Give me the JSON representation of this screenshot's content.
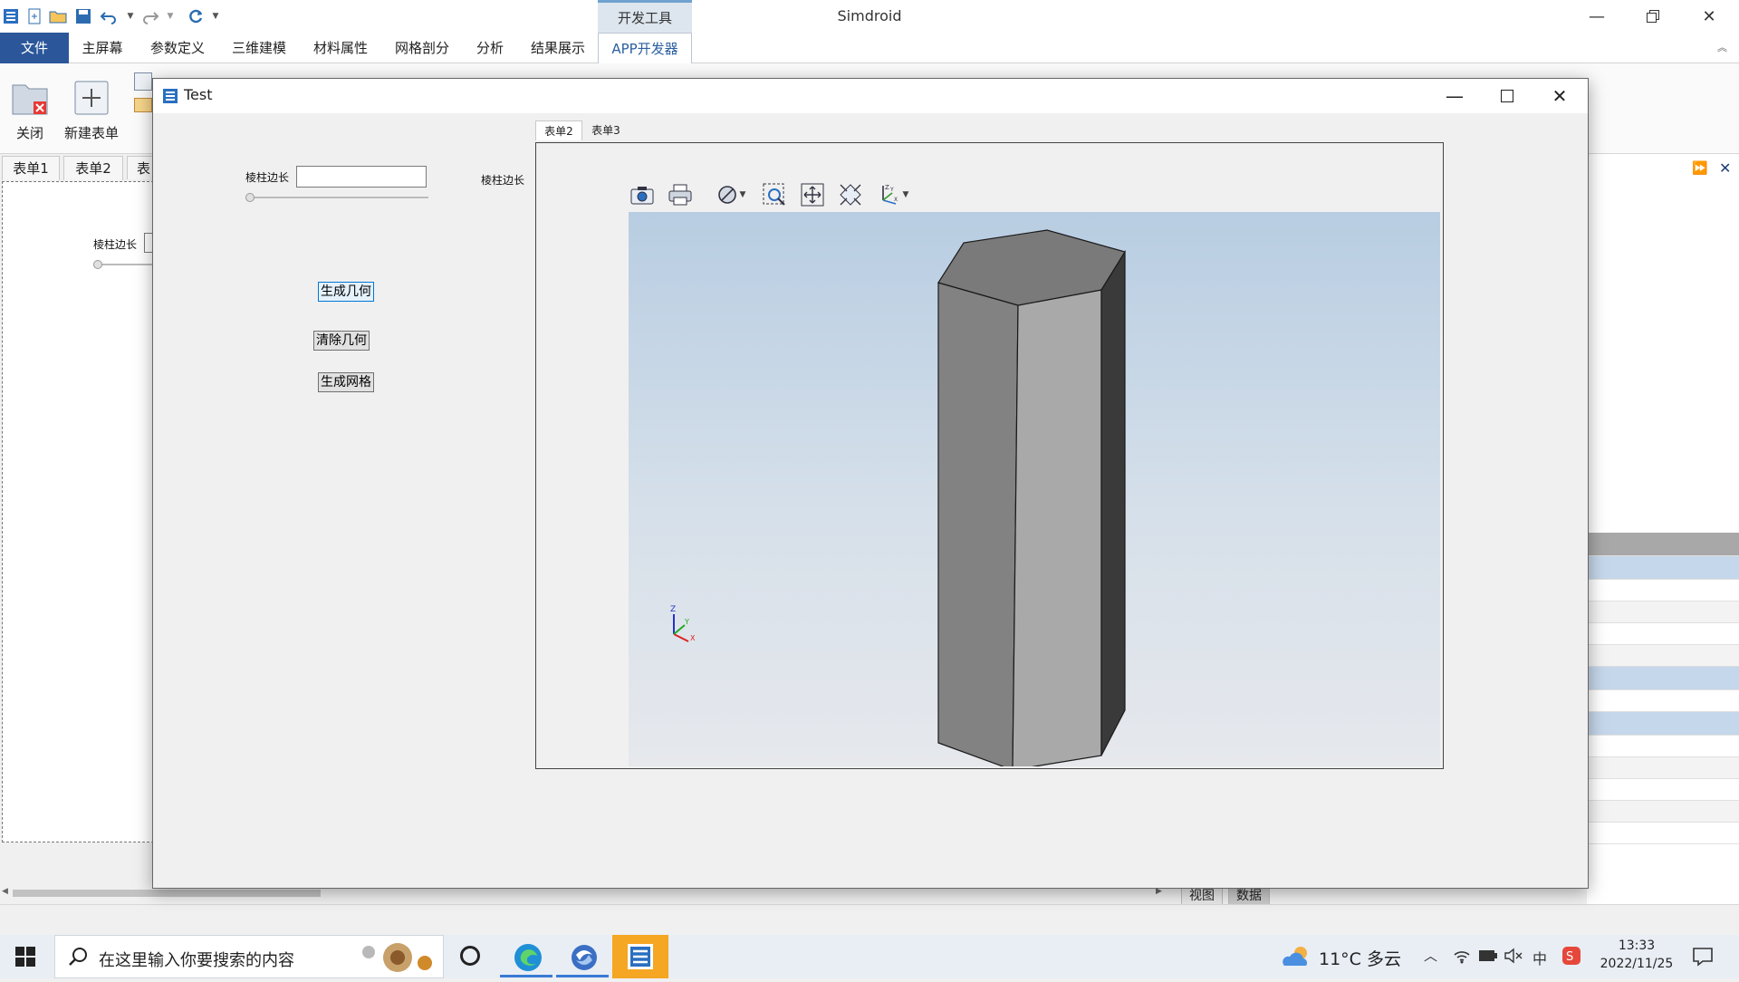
{
  "app": {
    "title": "Simdroid",
    "context_tab": "开发工具"
  },
  "ribbon_tabs": [
    {
      "label": "文件"
    },
    {
      "label": "主屏幕"
    },
    {
      "label": "参数定义"
    },
    {
      "label": "三维建模"
    },
    {
      "label": "材料属性"
    },
    {
      "label": "网格剖分"
    },
    {
      "label": "分析"
    },
    {
      "label": "结果展示"
    },
    {
      "label": "APP开发器"
    }
  ],
  "ribbon": {
    "close_label": "关闭",
    "new_form_label": "新建表单"
  },
  "doc_tabs": [
    {
      "label": "表单1"
    },
    {
      "label": "表单2"
    },
    {
      "label": "表"
    }
  ],
  "doc": {
    "edge_label": "棱柱边长"
  },
  "bottom_tabs": {
    "view": "视图",
    "data": "数据"
  },
  "test_window": {
    "title": "Test",
    "edge_label": "棱柱边长",
    "edge_value": "",
    "slider_value": 0,
    "generate_geometry": "生成几何",
    "clear_geometry": "清除几何",
    "generate_mesh": "生成网格",
    "side_label": "棱柱边长",
    "inner_tabs": [
      {
        "label": "表单2",
        "active": true
      },
      {
        "label": "表单3",
        "active": false
      }
    ]
  },
  "viewer": {
    "toolbar": [
      "camera-icon",
      "print-icon",
      "no-render-icon",
      "zoom-box-icon",
      "pan-icon",
      "fit-view-icon",
      "axis-view-icon"
    ],
    "axis_labels": {
      "z": "Z",
      "y": "Y",
      "x": "X"
    },
    "model": "hexagonal-prism",
    "colors": {
      "bg_top": "#b8cde2",
      "bg_bottom": "#e6e8ec",
      "top_face": "#7a7a7a",
      "left_face": "#828282",
      "front_face": "#a9a9a9",
      "right_face": "#3a3a3a"
    }
  },
  "taskbar": {
    "search_placeholder": "在这里输入你要搜索的内容",
    "weather": "11°C 多云",
    "time": "13:33",
    "date": "2022/11/25",
    "ime": "中"
  }
}
